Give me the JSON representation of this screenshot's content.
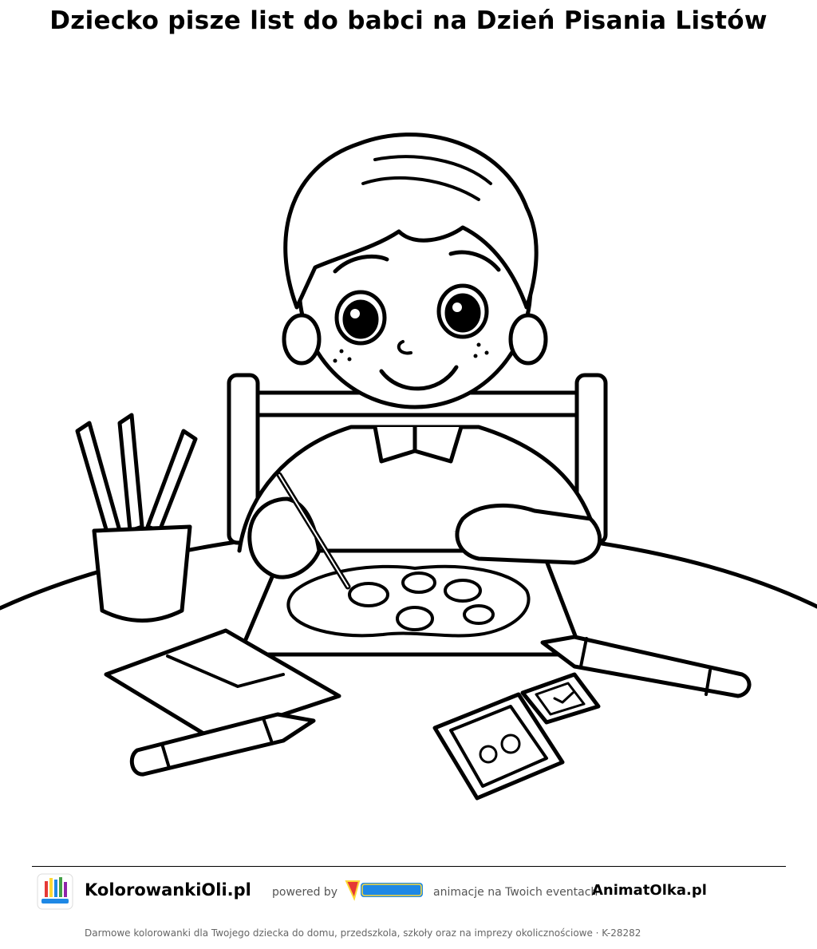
{
  "page": {
    "title": "Dziecko pisze list do babci na Dzień Pisania Listów"
  },
  "footer": {
    "brand": "KolorowankiOli.pl",
    "powered_by": "powered by",
    "partner_logo": "AnimatOlka",
    "tagline": "animacje na Twoich eventach",
    "partner_site": "AnimatOlka.pl",
    "note": "Darmowe kolorowanki dla Twojego dziecka do domu, przedszkola, szkoły oraz na imprezy okolicznościowe  ·  K-28282"
  },
  "colors": {
    "ink": "#000000",
    "paper": "#ffffff",
    "muted_text": "#555555",
    "logo_blue": "#1e88e5",
    "logo_red": "#e53935",
    "logo_yellow": "#fdd835"
  },
  "icons": {
    "site_logo": "kolorowanki-oli-logo-icon",
    "partner_logo": "animatolka-logo-icon"
  }
}
